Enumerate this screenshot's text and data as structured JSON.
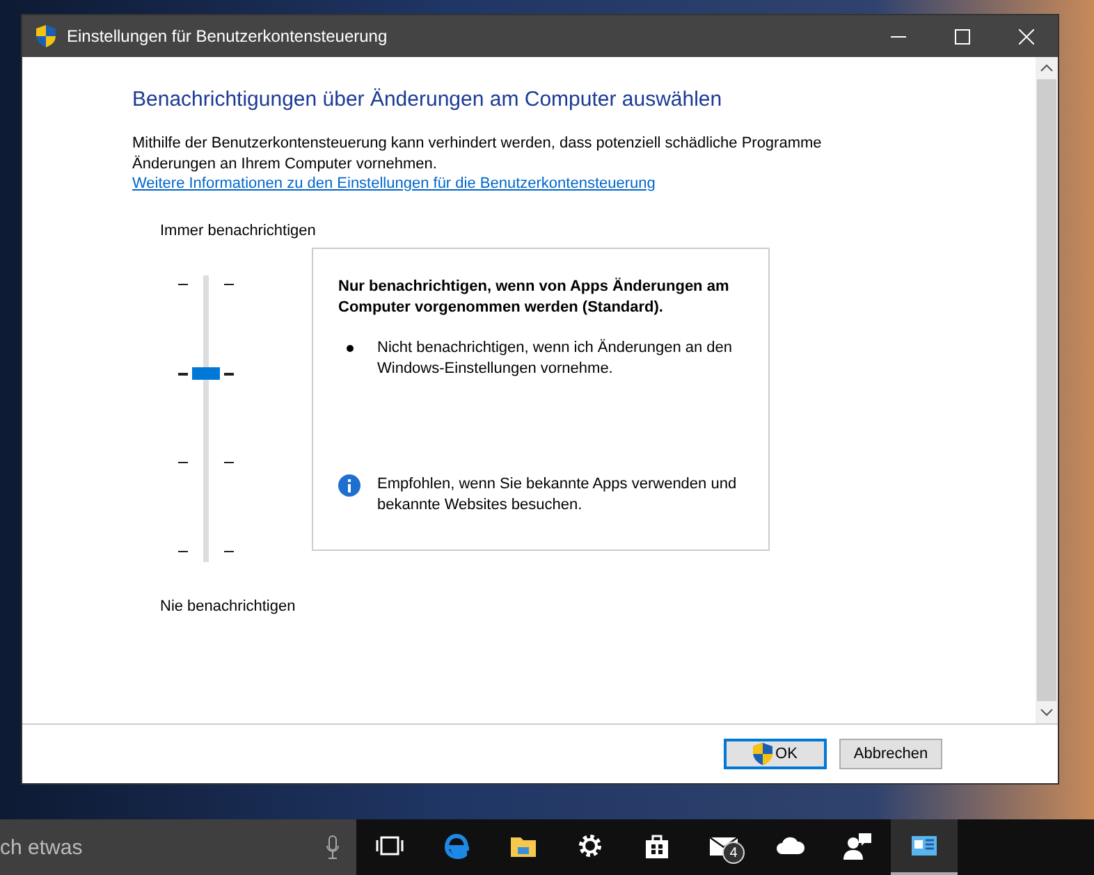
{
  "window": {
    "title": "Einstellungen für Benutzerkontensteuerung"
  },
  "heading": "Benachrichtigungen über Änderungen am Computer auswählen",
  "intro": "Mithilfe der Benutzerkontensteuerung kann verhindert werden, dass potenziell schädliche Programme Änderungen an Ihrem Computer vornehmen.",
  "link": "Weitere Informationen zu den Einstellungen für die Benutzerkontensteuerung",
  "slider": {
    "top_label": "Immer benachrichtigen",
    "bottom_label": "Nie benachrichtigen",
    "positions": [
      {
        "selected": false
      },
      {
        "selected": true
      },
      {
        "selected": false
      },
      {
        "selected": false
      }
    ]
  },
  "description": {
    "title": "Nur benachrichtigen, wenn von Apps Änderungen am Computer vorgenommen werden (Standard).",
    "bullets": [
      "Nicht benachrichtigen, wenn ich Änderungen an den Windows-Einstellungen vornehme."
    ],
    "note": "Empfohlen, wenn Sie bekannte Apps verwenden und bekannte Websites besuchen."
  },
  "buttons": [
    {
      "label": "OK",
      "kind": "admin",
      "focused": true
    },
    {
      "label": "Abbrechen",
      "kind": "plain",
      "focused": false
    }
  ],
  "taskbar": {
    "search_placeholder": "ch etwas",
    "items": [
      {
        "kind": "taskview",
        "selected": false
      },
      {
        "kind": "browser",
        "selected": false
      },
      {
        "kind": "folder",
        "selected": false
      },
      {
        "kind": "settings",
        "selected": false
      },
      {
        "kind": "store",
        "selected": false
      },
      {
        "kind": "mail",
        "selected": false,
        "badge": "4"
      },
      {
        "kind": "cloud",
        "selected": false
      },
      {
        "kind": "people",
        "selected": false
      },
      {
        "kind": "app",
        "selected": true
      }
    ]
  }
}
